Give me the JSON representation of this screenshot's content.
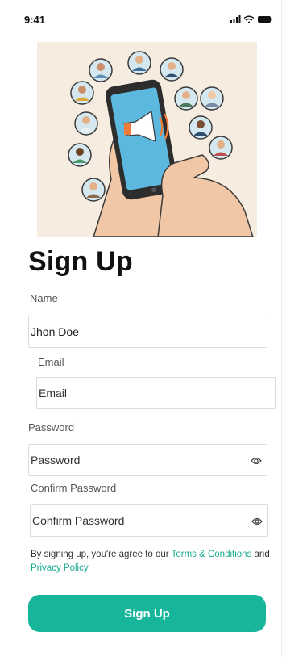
{
  "status_bar": {
    "time": "9:41",
    "icons": [
      "signal-icon",
      "wifi-icon",
      "battery-icon"
    ]
  },
  "hero": {
    "icons": [
      "phone-icon",
      "megaphone-icon",
      "hand-icon",
      "avatar-icon"
    ]
  },
  "title": "Sign Up",
  "form": {
    "name": {
      "label": "Name",
      "value": "Jhon Doe",
      "placeholder": ""
    },
    "email": {
      "label": "Email",
      "value": "",
      "placeholder": "Email"
    },
    "password": {
      "label": "Password",
      "value": "",
      "placeholder": "Password",
      "icon": "eye-icon"
    },
    "confirm_password": {
      "label": "Confirm Password",
      "value": "",
      "placeholder": "Confirm Password",
      "icon": "eye-icon"
    }
  },
  "terms": {
    "prefix": "By signing up, you're agree to our ",
    "terms_link": "Terms & Conditions",
    "middle": " and ",
    "privacy_link": "Privacy Policy"
  },
  "submit_label": "Sign Up",
  "colors": {
    "accent": "#17b59a",
    "link": "#1aa98f",
    "hero_bg": "#f6ece0"
  }
}
